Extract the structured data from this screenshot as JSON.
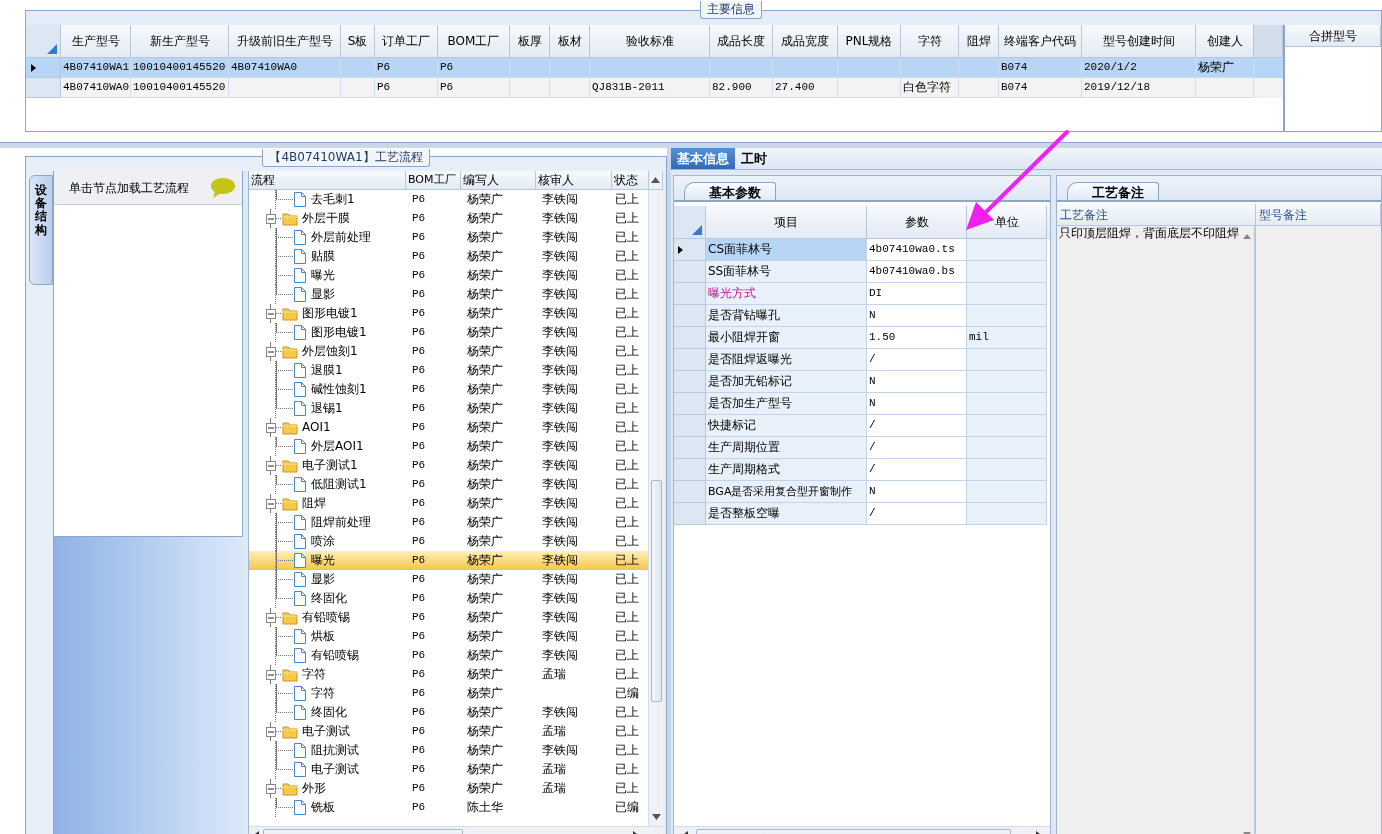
{
  "main_info": {
    "title": "主要信息",
    "columns": [
      "生产型号",
      "新生产型号",
      "升级前旧生产型号",
      "S板",
      "订单工厂",
      "BOM工厂",
      "板厚",
      "板材",
      "验收标准",
      "成品长度",
      "成品宽度",
      "PNL规格",
      "字符",
      "阻焊",
      "终端客户代码",
      "型号创建时间",
      "创建人"
    ],
    "rows": [
      {
        "selected": true,
        "cells": [
          "4B07410WA1",
          "10010400145520",
          "4B07410WA0",
          null,
          "P6",
          "P6",
          null,
          null,
          null,
          null,
          null,
          null,
          null,
          null,
          "B074",
          "2020/1/2",
          "杨荣广"
        ]
      },
      {
        "selected": false,
        "cells": [
          "4B07410WA0",
          "10010400145520",
          null,
          null,
          "P6",
          "P6",
          null,
          null,
          "QJ831B-2011",
          "82.900",
          "27.400",
          null,
          "白色字符",
          null,
          "B074",
          "2019/12/18",
          null
        ]
      }
    ]
  },
  "merge_panel": {
    "title": "合拼型号"
  },
  "process_flow": {
    "title": "【4B07410WA1】工艺流程",
    "side_tab": "设备结构",
    "hint": "单击节点加载工艺流程",
    "columns": [
      "流程",
      "BOM工厂",
      "编写人",
      "核审人",
      "状态"
    ],
    "tree": [
      {
        "children": [
          {
            "name": "去毛刺1",
            "bom": "P6",
            "author": "杨荣广",
            "reviewer": "李铁闯",
            "status": "已上",
            "selected": false
          }
        ]
      },
      {
        "name": "外层干膜",
        "bom": "P6",
        "author": "杨荣广",
        "reviewer": "李铁闯",
        "status": "已上",
        "selected": false,
        "expanded": true,
        "children": [
          {
            "name": "外层前处理",
            "bom": "P6",
            "author": "杨荣广",
            "reviewer": "李铁闯",
            "status": "已上",
            "selected": false
          },
          {
            "name": "贴膜",
            "bom": "P6",
            "author": "杨荣广",
            "reviewer": "李铁闯",
            "status": "已上",
            "selected": false
          },
          {
            "name": "曝光",
            "bom": "P6",
            "author": "杨荣广",
            "reviewer": "李铁闯",
            "status": "已上",
            "selected": false
          },
          {
            "name": "显影",
            "bom": "P6",
            "author": "杨荣广",
            "reviewer": "李铁闯",
            "status": "已上",
            "selected": false
          }
        ]
      },
      {
        "name": "图形电镀1",
        "bom": "P6",
        "author": "杨荣广",
        "reviewer": "李铁闯",
        "status": "已上",
        "selected": false,
        "expanded": true,
        "children": [
          {
            "name": "图形电镀1",
            "bom": "P6",
            "author": "杨荣广",
            "reviewer": "李铁闯",
            "status": "已上",
            "selected": false
          }
        ]
      },
      {
        "name": "外层蚀刻1",
        "bom": "P6",
        "author": "杨荣广",
        "reviewer": "李铁闯",
        "status": "已上",
        "selected": false,
        "expanded": true,
        "children": [
          {
            "name": "退膜1",
            "bom": "P6",
            "author": "杨荣广",
            "reviewer": "李铁闯",
            "status": "已上",
            "selected": false
          },
          {
            "name": "碱性蚀刻1",
            "bom": "P6",
            "author": "杨荣广",
            "reviewer": "李铁闯",
            "status": "已上",
            "selected": false
          },
          {
            "name": "退锡1",
            "bom": "P6",
            "author": "杨荣广",
            "reviewer": "李铁闯",
            "status": "已上",
            "selected": false
          }
        ]
      },
      {
        "name": "AOI1",
        "bom": "P6",
        "author": "杨荣广",
        "reviewer": "李铁闯",
        "status": "已上",
        "selected": false,
        "expanded": true,
        "children": [
          {
            "name": "外层AOI1",
            "bom": "P6",
            "author": "杨荣广",
            "reviewer": "李铁闯",
            "status": "已上",
            "selected": false
          }
        ]
      },
      {
        "name": "电子测试1",
        "bom": "P6",
        "author": "杨荣广",
        "reviewer": "李铁闯",
        "status": "已上",
        "selected": false,
        "expanded": true,
        "children": [
          {
            "name": "低阻测试1",
            "bom": "P6",
            "author": "杨荣广",
            "reviewer": "李铁闯",
            "status": "已上",
            "selected": false
          }
        ]
      },
      {
        "name": "阻焊",
        "bom": "P6",
        "author": "杨荣广",
        "reviewer": "李铁闯",
        "status": "已上",
        "selected": false,
        "expanded": true,
        "children": [
          {
            "name": "阻焊前处理",
            "bom": "P6",
            "author": "杨荣广",
            "reviewer": "李铁闯",
            "status": "已上",
            "selected": false
          },
          {
            "name": "喷涂",
            "bom": "P6",
            "author": "杨荣广",
            "reviewer": "李铁闯",
            "status": "已上",
            "selected": false
          },
          {
            "name": "曝光",
            "bom": "P6",
            "author": "杨荣广",
            "reviewer": "李铁闯",
            "status": "已上",
            "selected": true
          },
          {
            "name": "显影",
            "bom": "P6",
            "author": "杨荣广",
            "reviewer": "李铁闯",
            "status": "已上",
            "selected": false
          },
          {
            "name": "终固化",
            "bom": "P6",
            "author": "杨荣广",
            "reviewer": "李铁闯",
            "status": "已上",
            "selected": false
          }
        ]
      },
      {
        "name": "有铅喷锡",
        "bom": "P6",
        "author": "杨荣广",
        "reviewer": "李铁闯",
        "status": "已上",
        "selected": false,
        "expanded": true,
        "children": [
          {
            "name": "烘板",
            "bom": "P6",
            "author": "杨荣广",
            "reviewer": "李铁闯",
            "status": "已上",
            "selected": false
          },
          {
            "name": "有铅喷锡",
            "bom": "P6",
            "author": "杨荣广",
            "reviewer": "李铁闯",
            "status": "已上",
            "selected": false
          }
        ]
      },
      {
        "name": "字符",
        "bom": "P6",
        "author": "杨荣广",
        "reviewer": "孟瑞",
        "status": "已上",
        "selected": false,
        "expanded": true,
        "children": [
          {
            "name": "字符",
            "bom": "P6",
            "author": "杨荣广",
            "status": "已编",
            "selected": false
          },
          {
            "name": "终固化",
            "bom": "P6",
            "author": "杨荣广",
            "reviewer": "李铁闯",
            "status": "已上",
            "selected": false
          }
        ]
      },
      {
        "name": "电子测试",
        "bom": "P6",
        "author": "杨荣广",
        "reviewer": "孟瑞",
        "status": "已上",
        "selected": false,
        "expanded": true,
        "children": [
          {
            "name": "阻抗测试",
            "bom": "P6",
            "author": "杨荣广",
            "reviewer": "李铁闯",
            "status": "已上",
            "selected": false
          },
          {
            "name": "电子测试",
            "bom": "P6",
            "author": "杨荣广",
            "reviewer": "孟瑞",
            "status": "已上",
            "selected": false
          }
        ]
      },
      {
        "name": "外形",
        "bom": "P6",
        "author": "杨荣广",
        "reviewer": "孟瑞",
        "status": "已上",
        "selected": false,
        "expanded": true,
        "children": [
          {
            "name": "铣板",
            "bom": "P6",
            "author": "陈土华",
            "status": "已编",
            "selected": false
          }
        ]
      }
    ]
  },
  "detail": {
    "tabs": [
      {
        "label": "基本信息",
        "selected": true
      },
      {
        "label": "工时",
        "selected": false
      }
    ],
    "params": {
      "tab": "基本参数",
      "columns": [
        "项目",
        "参数",
        "单位"
      ],
      "rows": [
        {
          "item": "CS面菲林号",
          "value": "4b07410wa0.ts",
          "selected": true,
          "flagged": false
        },
        {
          "item": "SS面菲林号",
          "value": "4b07410wa0.bs",
          "selected": false,
          "flagged": false
        },
        {
          "item": "曝光方式",
          "value": "DI",
          "selected": false,
          "flagged": true
        },
        {
          "item": "是否背钻曝孔",
          "value": "N",
          "selected": false,
          "flagged": false
        },
        {
          "item": "最小阻焊开窗",
          "value": "1.50",
          "unit": "mil",
          "selected": false,
          "flagged": false
        },
        {
          "item": "是否阻焊返曝光",
          "value": "/",
          "selected": false,
          "flagged": false
        },
        {
          "item": "是否加无铅标记",
          "value": "N",
          "selected": false,
          "flagged": false
        },
        {
          "item": "是否加生产型号",
          "value": "N",
          "selected": false,
          "flagged": false
        },
        {
          "item": "快捷标记",
          "value": "/",
          "selected": false,
          "flagged": false
        },
        {
          "item": "生产周期位置",
          "value": "/",
          "selected": false,
          "flagged": false
        },
        {
          "item": "生产周期格式",
          "value": "/",
          "selected": false,
          "flagged": false
        },
        {
          "item": "BGA是否采用复合型开窗制作",
          "value": "N",
          "selected": false,
          "flagged": false
        },
        {
          "item": "是否整板空曝",
          "value": "/",
          "selected": false,
          "flagged": false
        }
      ]
    },
    "notes": {
      "tab": "工艺备注",
      "columns": [
        "工艺备注",
        "型号备注"
      ],
      "text": "只印顶层阻焊，背面底层不印阻焊"
    }
  }
}
